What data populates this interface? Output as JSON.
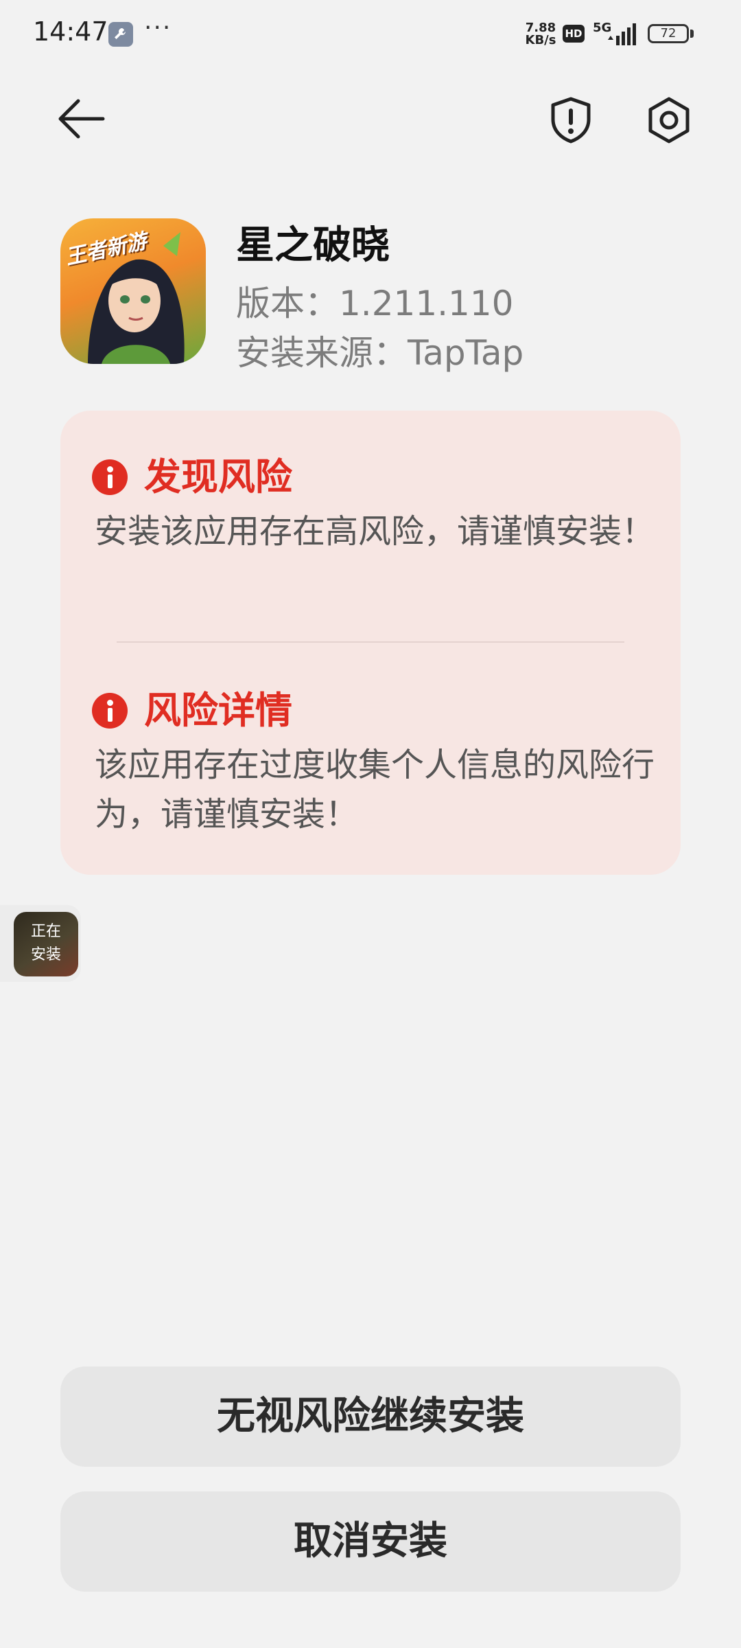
{
  "status_bar": {
    "time": "14:47",
    "extra": "···",
    "speed_value": "7.88",
    "speed_unit": "KB/s",
    "hd_label": "HD",
    "network": "5G",
    "battery": "72"
  },
  "icons": {
    "back": "back-arrow-icon",
    "shield": "shield-alert-icon",
    "settings": "settings-icon",
    "wrench": "wrench-icon"
  },
  "app": {
    "icon_badge": "王者新游",
    "name": "星之破晓",
    "version": "版本：1.211.110",
    "source": "安装来源：TapTap"
  },
  "risk": {
    "found_title": "发现风险",
    "found_text": "安装该应用存在高风险，请谨慎安装！",
    "detail_title": "风险详情",
    "detail_text": "该应用存在过度收集个人信息的风险行为，请谨慎安装！"
  },
  "installing": {
    "line1": "正在",
    "line2": "安装"
  },
  "actions": {
    "continue_label": "无视风险继续安装",
    "cancel_label": "取消安装"
  },
  "colors": {
    "risk_red": "#e02d22",
    "card_bg": "#f7e6e3",
    "page_bg": "#f2f2f2",
    "button_bg": "#e6e6e6"
  }
}
